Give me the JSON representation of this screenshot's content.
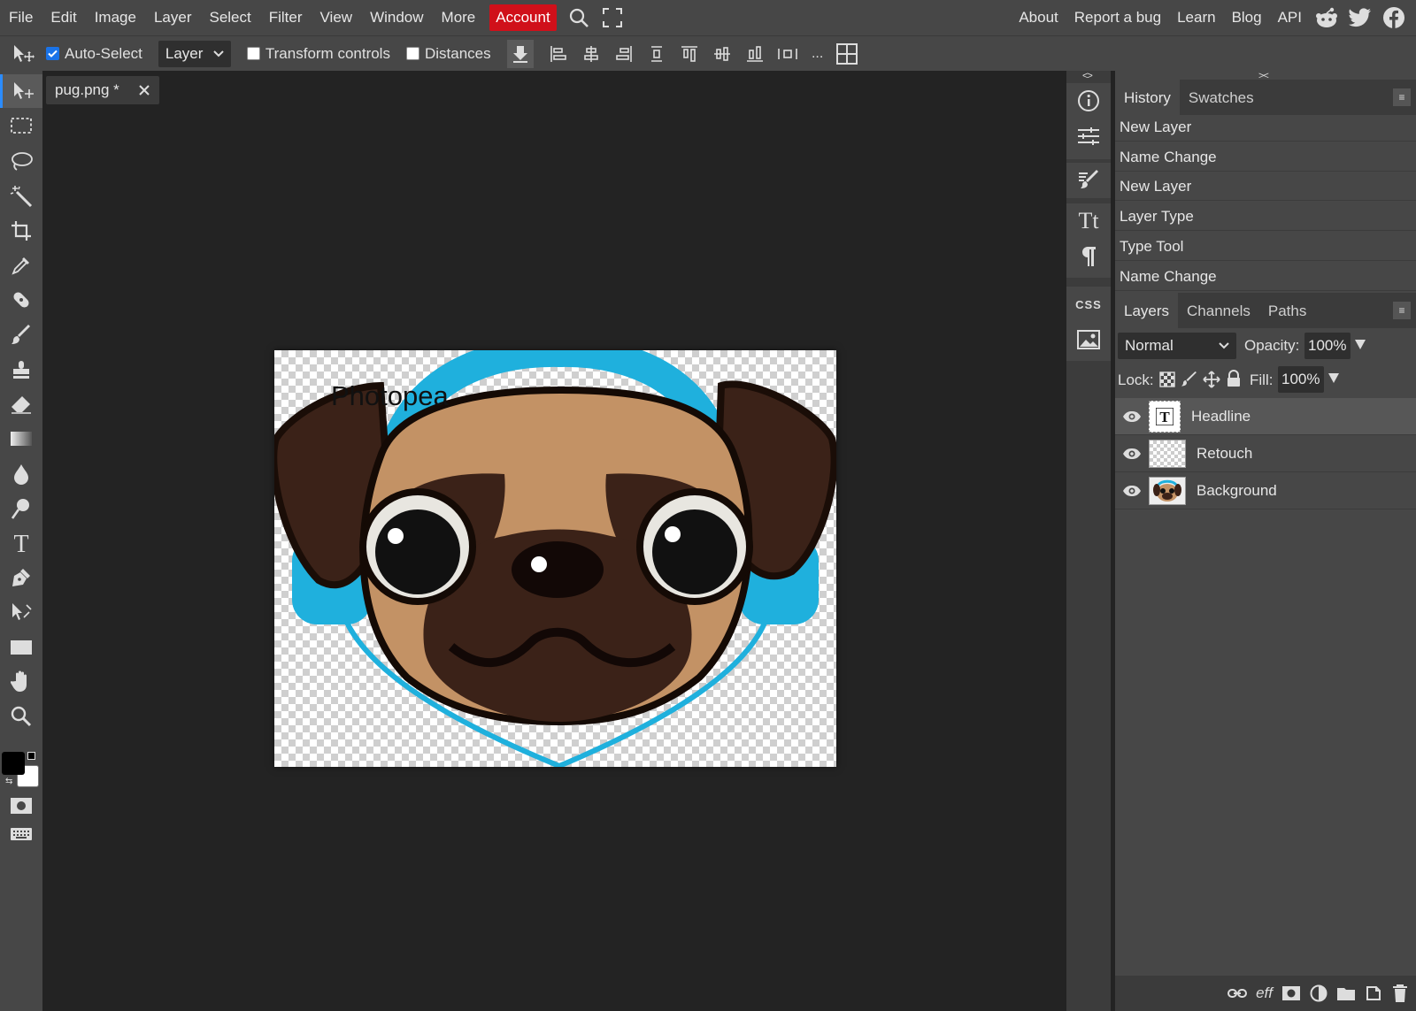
{
  "menubar": {
    "items": [
      "File",
      "Edit",
      "Image",
      "Layer",
      "Select",
      "Filter",
      "View",
      "Window",
      "More"
    ],
    "account": "Account",
    "right": [
      "About",
      "Report a bug",
      "Learn",
      "Blog",
      "API"
    ],
    "icons": [
      "search-icon",
      "fullscreen-icon",
      "reddit-icon",
      "twitter-icon",
      "facebook-icon"
    ],
    "accent": "#d0101a"
  },
  "optionsbar": {
    "auto_select_label": "Auto-Select",
    "auto_select_checked": true,
    "select_value": "Layer",
    "transform_label": "Transform controls",
    "transform_checked": false,
    "distances_label": "Distances",
    "distances_checked": false,
    "more": "..."
  },
  "document": {
    "tab_title": "pug.png *",
    "canvas_text": "Photopea"
  },
  "history": {
    "tabs": [
      "History",
      "Swatches"
    ],
    "items": [
      "New Layer",
      "Name Change",
      "New Layer",
      "Layer Type",
      "Type Tool",
      "Name Change"
    ]
  },
  "layers": {
    "tabs": [
      "Layers",
      "Channels",
      "Paths"
    ],
    "blend_mode": "Normal",
    "opacity_label": "Opacity:",
    "opacity_value": "100%",
    "lock_label": "Lock:",
    "fill_label": "Fill:",
    "fill_value": "100%",
    "items": [
      {
        "name": "Headline",
        "type": "text",
        "selected": true
      },
      {
        "name": "Retouch",
        "type": "transparent",
        "selected": false
      },
      {
        "name": "Background",
        "type": "image",
        "selected": false
      }
    ]
  },
  "iconcol": {
    "css_label": "CSS",
    "type_label": "Tt"
  },
  "colors": {
    "foreground": "#000000",
    "background": "#ffffff",
    "active_tool_accent": "#2b8cff"
  }
}
